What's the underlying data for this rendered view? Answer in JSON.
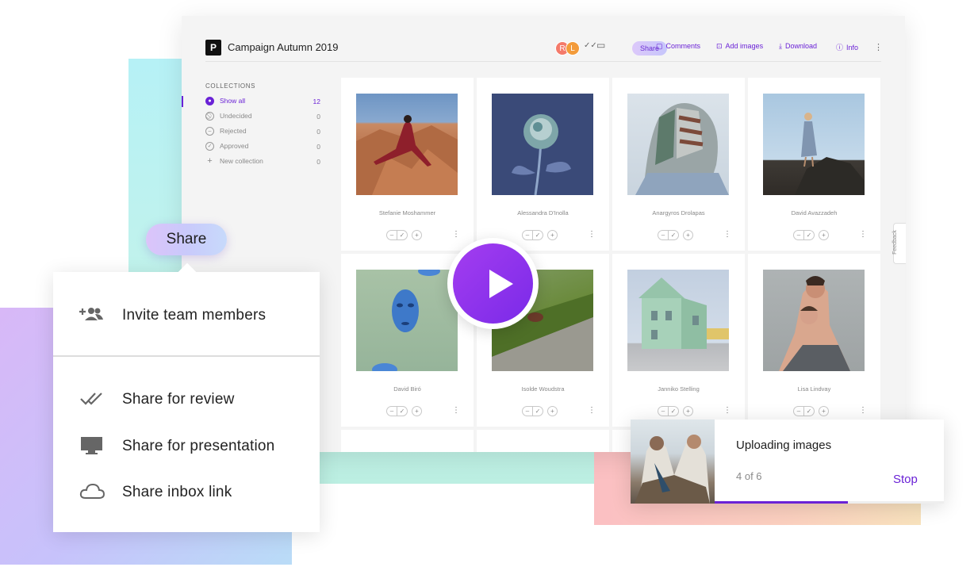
{
  "app": {
    "logo_letter": "P",
    "title": "Campaign Autumn 2019",
    "avatars": [
      "R",
      "L"
    ],
    "toolbar": {
      "share": "Share",
      "comments": "Comments",
      "add_images": "Add images",
      "download": "Download",
      "info": "Info"
    }
  },
  "sidebar": {
    "heading": "COLLECTIONS",
    "items": [
      {
        "label": "Show all",
        "count": "12"
      },
      {
        "label": "Undecided",
        "count": "0"
      },
      {
        "label": "Rejected",
        "count": "0"
      },
      {
        "label": "Approved",
        "count": "0"
      },
      {
        "label": "New collection",
        "count": "0"
      }
    ]
  },
  "photos": [
    {
      "caption": "Stefanie Moshammer"
    },
    {
      "caption": "Alessandra D'Inolla"
    },
    {
      "caption": "Anargyros Drolapas"
    },
    {
      "caption": "David Avazzadeh"
    },
    {
      "caption": "David Biró"
    },
    {
      "caption": "Isolde Woudstra"
    },
    {
      "caption": "Janniko Stelling"
    },
    {
      "caption": "Lisa Lindvay"
    }
  ],
  "feedback": "Feedback",
  "share_popup": {
    "button": "Share",
    "items": [
      {
        "label": "Invite team members",
        "icon": "add-people-icon"
      },
      {
        "label": "Share for review",
        "icon": "double-check-icon"
      },
      {
        "label": "Share for presentation",
        "icon": "monitor-icon"
      },
      {
        "label": "Share inbox link",
        "icon": "cloud-icon"
      }
    ]
  },
  "upload": {
    "title": "Uploading images",
    "progress_text": "4 of 6",
    "progress": 0.58,
    "stop": "Stop"
  },
  "colors": {
    "accent": "#6a22d6",
    "play": "#8f33ee"
  }
}
